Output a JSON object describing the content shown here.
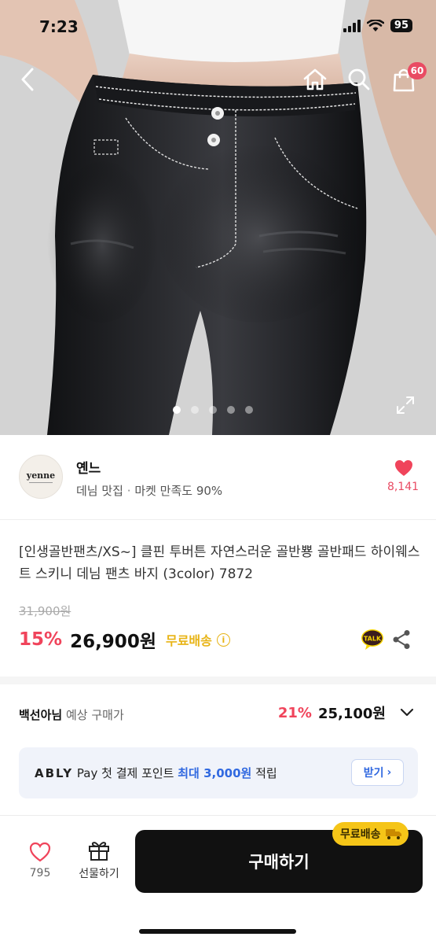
{
  "status_bar": {
    "time": "7:23",
    "battery": "95"
  },
  "nav": {
    "cart_count": "60",
    "back_icon": "chevron-left-icon",
    "home_icon": "home-icon",
    "search_icon": "search-icon",
    "cart_icon": "shopping-bag-icon"
  },
  "gallery": {
    "total_images": 5,
    "active_index": 0
  },
  "store": {
    "logo_text": "yenne",
    "name": "옌느",
    "category": "데님 맛집",
    "separator": "·",
    "satisfaction": "마켓 만족도 90%",
    "likes": "8,141"
  },
  "product": {
    "title": "[인생골반팬츠/XS~] 클핀 투버튼 자연스러운 골반뿅 골반패드 하이웨스트 스키니 데님 팬츠 바지 (3color) 7872",
    "original_price": "31,900원",
    "discount": "15%",
    "price": "26,900원",
    "free_shipping": "무료배송",
    "info_symbol": "i",
    "talk_label": "TALK"
  },
  "expected_price": {
    "user": "백선아님",
    "label": " 예상 구매가",
    "discount": "21%",
    "price": "25,100원"
  },
  "pay_banner": {
    "brand": "ABLY",
    "brand_suffix": "Pay",
    "text_before": " 첫 결제 포인트 ",
    "highlight": "최대 3,000원",
    "text_after": " 적립",
    "button": "받기",
    "button_arrow": "›"
  },
  "bottom_bar": {
    "favorite_count": "795",
    "gift_label": "선물하기",
    "buy_label": "구매하기",
    "shipping_badge": "무료배송"
  },
  "colors": {
    "accent_red": "#f0445b",
    "free_ship_yellow": "#e8b416",
    "pay_blue": "#3169e0",
    "buy_black": "#111111"
  }
}
